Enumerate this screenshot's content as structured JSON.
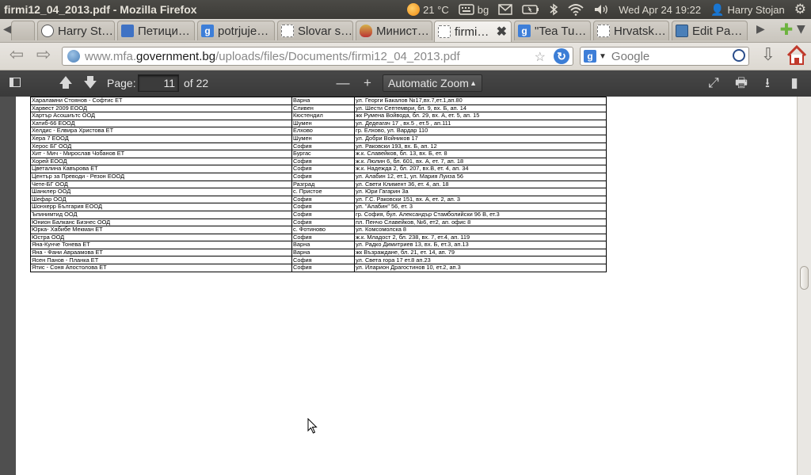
{
  "window": {
    "title": "firmi12_04_2013.pdf - Mozilla Firefox"
  },
  "indicators": {
    "weather": "21 °C",
    "keyboard": "bg",
    "datetime": "Wed Apr 24 19:22",
    "user": "Harry Stojan"
  },
  "tabs": [
    {
      "label": "",
      "icon": "generic"
    },
    {
      "label": "Harry St…",
      "icon": "ribbon-icon"
    },
    {
      "label": "Петици…",
      "icon": "people-icon"
    },
    {
      "label": "potrjuje…",
      "icon": "google-icon"
    },
    {
      "label": "Slovar s…",
      "icon": "blank-page-icon"
    },
    {
      "label": "Минист…",
      "icon": "crest-icon"
    },
    {
      "label": "firmi…",
      "icon": "blank-page-icon",
      "active": true
    },
    {
      "label": "\"Tea Tu…",
      "icon": "google-icon"
    },
    {
      "label": "Hrvatsk…",
      "icon": "blank-page-icon"
    },
    {
      "label": "Edit Pa…",
      "icon": "pen-icon"
    }
  ],
  "url": {
    "scheme_host_prefix": "www.mfa.",
    "host_main": "government.bg",
    "path": "/uploads/files/Documents/firmi12_04_2013.pdf"
  },
  "search": {
    "placeholder": "Google",
    "engine_letter": "g"
  },
  "pdf": {
    "page_label": "Page:",
    "page_current": "11",
    "page_of": "of 22",
    "zoom": "Automatic Zoom",
    "zoom_out": "—",
    "zoom_in": "+"
  },
  "table": {
    "rows": [
      [
        "Хараламни Стоянов - Софтис ЕТ",
        "Варна",
        "ул. Георги Бакалов №17,вх.7,ет.1,ап.80"
      ],
      [
        "Харвест 2009 ЕООД",
        "Сливен",
        "ул. Шести Септември, бл. 9, вх. Б, ап. 14"
      ],
      [
        "Хартър Асошиътс ООД",
        "Кюстендил",
        "жк Румена Войвода, бл. 29, вх. А, ет. 5, ап. 15"
      ],
      [
        "Хатиб-66 ЕООД",
        "Шумен",
        "ул. Дедеагач 17 , вх.5 , ет.5 , ап.111"
      ],
      [
        "Хелдис - Елвира Христова ЕТ",
        "Елхово",
        "гр. Елхово, ул. Вардар 110"
      ],
      [
        "Хера 7 ЕООД",
        "Шумен",
        "ул. Добри Войников 17"
      ],
      [
        "Херос БГ ООД",
        "София",
        "ул. Раковски 193, вх. Б, ап. 12"
      ],
      [
        "Хит - Мич - Мирослав Чобанов ЕТ",
        "Бургас",
        "ж.к. Славейков, бл. 13, вх. Б, ет. 8"
      ],
      [
        "Хорей ЕООД",
        "София",
        "ж.к. Люлин 6, бл. 601, вх. А, ет. 7, ап. 18"
      ],
      [
        "Цветалина Кавърова ЕТ",
        "София",
        "ж.к. Надежда 2, бл. 207, вх.В, ет. 4, ап. 34"
      ],
      [
        "Център за Преводи - Резон ЕООД",
        "София",
        "ул. Алабин 12, ет.1, ул. Мария Луиза 56"
      ],
      [
        "Чете-БГ ООД",
        "Разград",
        "ул. Свети Климент 36, ет. 4, ап. 18"
      ],
      [
        "Шанклер ООД",
        "с. Пристое",
        "ул. Юри Гагарин 3а"
      ],
      [
        "Шефар ООД",
        "София",
        "ул. Г.С. Раковски 151, вх. А, ет. 2, ап. 3"
      ],
      [
        "Шонхерр България ЕООД",
        "София",
        "ул. \"Алабин\" 56, ет. 3"
      ],
      [
        "Ъпинимтид ООД",
        "София",
        "гр. София, бул. Александър Стамболийски 96 В, ет.3"
      ],
      [
        "Юнион Балканс Бизнес ООД",
        "София",
        "пл. Пенчо Славейков, №6, ет2, ап. офис 8"
      ],
      [
        "Юрка- Хабибе Мекман ЕТ",
        "с. Фотиново",
        "ул. Комсомолска 8"
      ],
      [
        "Юстра ООД",
        "София",
        "ж.к. Младост 2, бл. 238, вх. 7, ет.4, ап. 119"
      ],
      [
        "Яна-Кунче Тонева ЕТ",
        "Варна",
        "ул. Радко Димитриев 13, вх. Б, ет.3, ап.13"
      ],
      [
        "Яна - Фани Авраамова ЕТ",
        "Варна",
        "жк Възраждане, бл. 21, ет. 14, ап. 79"
      ],
      [
        "Ясен Панов - Планка ЕТ",
        "София",
        "ул. Света гора 17 ет.8 ап.23"
      ],
      [
        "Ятис - Соня Апостолова ЕТ",
        "София",
        "ул. Иларион Драгостинов 10, ет.2, ап.3"
      ]
    ]
  }
}
